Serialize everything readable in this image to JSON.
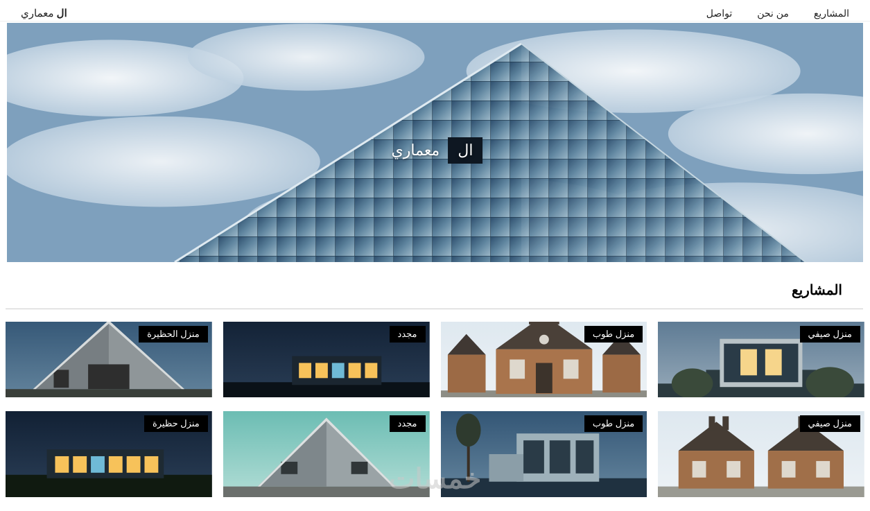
{
  "brand": {
    "bold": "ال",
    "rest": " معماري"
  },
  "nav": {
    "items": [
      {
        "label": "تواصل"
      },
      {
        "label": "من نحن"
      },
      {
        "label": "المشاريع"
      }
    ]
  },
  "hero": {
    "box": "ال",
    "plain": "معماري"
  },
  "section_title": "المشاريع",
  "projects_row1": [
    {
      "label": "منزل صيفي",
      "scene": "summer1"
    },
    {
      "label": "منزل طوب",
      "scene": "brick1"
    },
    {
      "label": "مجدد",
      "scene": "renov1"
    },
    {
      "label": "منزل الحظيرة",
      "scene": "barn1"
    }
  ],
  "projects_row2": [
    {
      "label": "منزل صيفي",
      "scene": "summer2"
    },
    {
      "label": "منزل طوب",
      "scene": "brick2"
    },
    {
      "label": "مجدد",
      "scene": "renov2"
    },
    {
      "label": "منزل حظيرة",
      "scene": "barn2"
    }
  ],
  "watermark": "خمسات"
}
